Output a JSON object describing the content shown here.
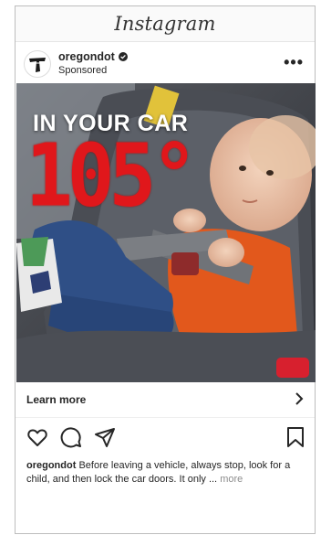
{
  "header": {
    "logo": "Instagram"
  },
  "post": {
    "username": "oregondot",
    "sponsored": "Sponsored",
    "overlay_title": "IN YOUR CAR",
    "overlay_temp": "105°",
    "cta_label": "Learn more",
    "caption_user": "oregondot",
    "caption_text": "Before leaving a vehicle, always stop, look for a child, and then lock the car doors. It only ...",
    "caption_more": "more"
  },
  "icons": {
    "avatar": "odot-logo-icon",
    "verified": "verified-badge-icon",
    "menu": "more-options-icon",
    "cta": "chevron-right-icon",
    "like": "heart-icon",
    "comment": "comment-icon",
    "share": "send-icon",
    "save": "bookmark-icon"
  },
  "colors": {
    "temp_red": "#e0171b",
    "text": "#262626",
    "muted": "#8e8e8e"
  }
}
